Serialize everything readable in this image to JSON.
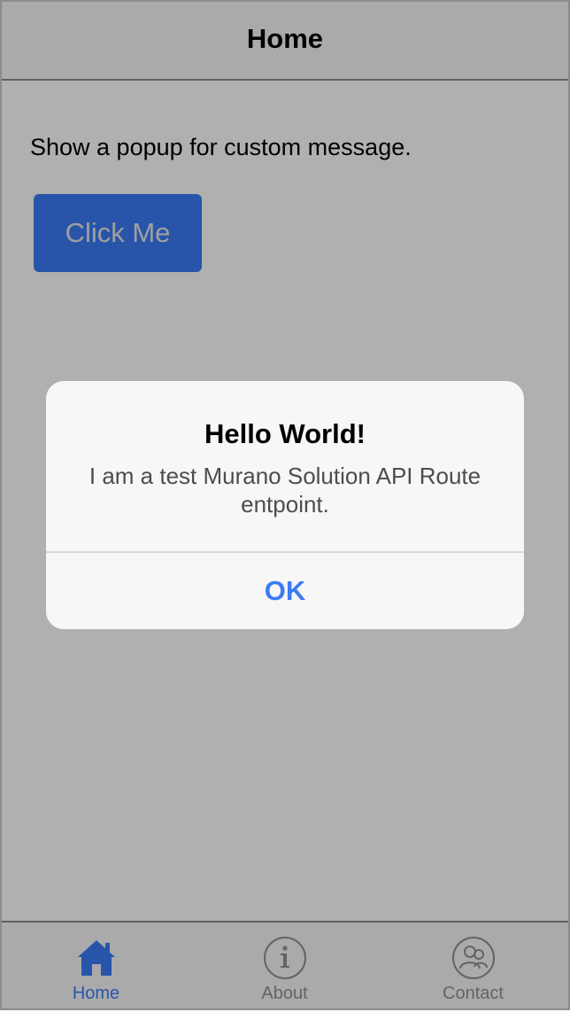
{
  "navbar": {
    "title": "Home"
  },
  "main": {
    "description": "Show a popup for custom message.",
    "button_label": "Click Me"
  },
  "alert": {
    "title": "Hello World!",
    "message": "I am a test Murano Solution API Route entpoint.",
    "ok_label": "OK"
  },
  "tabbar": {
    "items": [
      {
        "label": "Home",
        "icon": "home-icon",
        "active": true
      },
      {
        "label": "About",
        "icon": "info-icon",
        "active": false
      },
      {
        "label": "Contact",
        "icon": "contact-icon",
        "active": false
      }
    ]
  },
  "colors": {
    "accent": "#3a7bf6",
    "overlay": "rgba(0,0,0,0.31)",
    "tab_inactive": "#919191"
  }
}
